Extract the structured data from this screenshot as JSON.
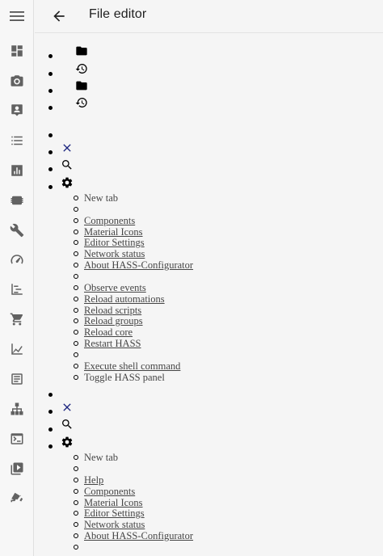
{
  "header": {
    "title": "File editor"
  },
  "sidebar": {
    "menu_icon": "menu-icon",
    "items": [
      {
        "icon": "overview-icon"
      },
      {
        "icon": "camera-icon"
      },
      {
        "icon": "account-box-icon"
      },
      {
        "icon": "list-icon"
      },
      {
        "icon": "bar-chart-icon"
      },
      {
        "icon": "chip-icon"
      },
      {
        "icon": "wrench-icon"
      },
      {
        "icon": "gauge-icon"
      },
      {
        "icon": "timeline-icon"
      },
      {
        "icon": "cart-icon"
      },
      {
        "icon": "area-chart-icon"
      },
      {
        "icon": "text-box-icon"
      },
      {
        "icon": "network-icon"
      },
      {
        "icon": "console-icon"
      },
      {
        "icon": "play-box-icon"
      },
      {
        "icon": "cctv-icon"
      }
    ]
  },
  "file_actions": [
    {
      "icon": "folder-icon"
    },
    {
      "icon": "history-icon"
    },
    {
      "icon": "folder-icon"
    },
    {
      "icon": "history-icon"
    }
  ],
  "menu1": {
    "new_tab": "New tab",
    "group1": [
      "Components",
      "Material Icons",
      "Editor Settings",
      "Network status",
      "About HASS-Configurator"
    ],
    "group2": [
      "Observe events",
      "Reload automations",
      "Reload scripts",
      "Reload groups",
      "Reload core",
      "Restart HASS"
    ],
    "group3_links": [
      "Execute shell command"
    ],
    "group3_text": [
      "Toggle HASS panel"
    ]
  },
  "menu2": {
    "new_tab": "New tab",
    "group1": [
      "Help",
      "Components",
      "Material Icons",
      "Editor Settings",
      "Network status",
      "About HASS-Configurator"
    ]
  },
  "colors": {
    "close_icon": "#1a237e",
    "sidebar_icon": "#626262",
    "text": "#454545"
  }
}
